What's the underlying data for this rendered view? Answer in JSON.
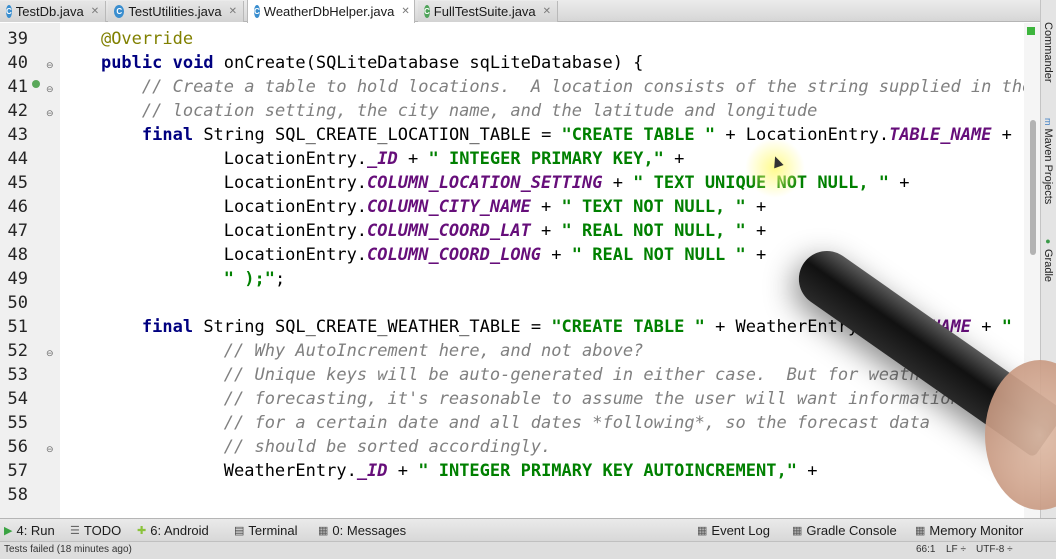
{
  "tabs": [
    {
      "label": "TestDb.java",
      "icon": "java-class-icon",
      "active": false
    },
    {
      "label": "TestUtilities.java",
      "icon": "java-class-icon",
      "active": false
    },
    {
      "label": "WeatherDbHelper.java",
      "icon": "java-class-icon",
      "active": true
    },
    {
      "label": "FullTestSuite.java",
      "icon": "java-class-icon",
      "active": false
    }
  ],
  "right_tools": [
    {
      "label": "Commander"
    },
    {
      "label": "Maven Projects"
    },
    {
      "label": "Gradle"
    }
  ],
  "line_numbers": [
    "39",
    "40",
    "41",
    "42",
    "43",
    "44",
    "45",
    "46",
    "47",
    "48",
    "49",
    "50",
    "51",
    "52",
    "53",
    "54",
    "55",
    "56",
    "57",
    "58"
  ],
  "code": [
    [
      {
        "t": "    "
      },
      {
        "c": "an",
        "t": "@Override"
      }
    ],
    [
      {
        "t": "    "
      },
      {
        "c": "kw",
        "t": "public void "
      },
      {
        "t": "onCreate(SQLiteDatabase sqLiteDatabase) {"
      }
    ],
    [
      {
        "t": "        "
      },
      {
        "c": "cm",
        "t": "// Create a table to hold locations.  A location consists of the string supplied in the"
      }
    ],
    [
      {
        "t": "        "
      },
      {
        "c": "cm",
        "t": "// location setting, the city name, and the latitude and longitude"
      }
    ],
    [
      {
        "t": "        "
      },
      {
        "c": "kw",
        "t": "final "
      },
      {
        "t": "String SQL_CREATE_LOCATION_TABLE = "
      },
      {
        "c": "st",
        "t": "\"CREATE TABLE \""
      },
      {
        "t": " + LocationEntry."
      },
      {
        "c": "fd",
        "t": "TABLE_NAME"
      },
      {
        "t": " + "
      },
      {
        "c": "st",
        "t": "\""
      }
    ],
    [
      {
        "t": "                LocationEntry."
      },
      {
        "c": "fd",
        "t": "_ID"
      },
      {
        "t": " + "
      },
      {
        "c": "st",
        "t": "\" INTEGER PRIMARY KEY,\""
      },
      {
        "t": " +"
      }
    ],
    [
      {
        "t": "                LocationEntry."
      },
      {
        "c": "fd",
        "t": "COLUMN_LOCATION_SETTING"
      },
      {
        "t": " + "
      },
      {
        "c": "st",
        "t": "\" TEXT UNIQUE NOT NULL, \""
      },
      {
        "t": " +"
      }
    ],
    [
      {
        "t": "                LocationEntry."
      },
      {
        "c": "fd",
        "t": "COLUMN_CITY_NAME"
      },
      {
        "t": " + "
      },
      {
        "c": "st",
        "t": "\" TEXT NOT NULL, \""
      },
      {
        "t": " +"
      }
    ],
    [
      {
        "t": "                LocationEntry."
      },
      {
        "c": "fd",
        "t": "COLUMN_COORD_LAT"
      },
      {
        "t": " + "
      },
      {
        "c": "st",
        "t": "\" REAL NOT NULL, \""
      },
      {
        "t": " +"
      }
    ],
    [
      {
        "t": "                LocationEntry."
      },
      {
        "c": "fd",
        "t": "COLUMN_COORD_LONG"
      },
      {
        "t": " + "
      },
      {
        "c": "st",
        "t": "\" REAL NOT NULL \""
      },
      {
        "t": " +"
      }
    ],
    [
      {
        "t": "                "
      },
      {
        "c": "st",
        "t": "\" );\""
      },
      {
        "t": ";"
      }
    ],
    [],
    [
      {
        "t": "        "
      },
      {
        "c": "kw",
        "t": "final "
      },
      {
        "t": "String SQL_CREATE_WEATHER_TABLE = "
      },
      {
        "c": "st",
        "t": "\"CREATE TABLE \""
      },
      {
        "t": " + WeatherEntry."
      },
      {
        "c": "fd",
        "t": "TABLE_NAME"
      },
      {
        "t": " + "
      },
      {
        "c": "st",
        "t": "\" ("
      }
    ],
    [
      {
        "t": "                "
      },
      {
        "c": "cm",
        "t": "// Why AutoIncrement here, and not above?"
      }
    ],
    [
      {
        "t": "                "
      },
      {
        "c": "cm",
        "t": "// Unique keys will be auto-generated in either case.  But for weather"
      }
    ],
    [
      {
        "t": "                "
      },
      {
        "c": "cm",
        "t": "// forecasting, it's reasonable to assume the user will want information"
      }
    ],
    [
      {
        "t": "                "
      },
      {
        "c": "cm",
        "t": "// for a certain date and all dates *following*, so the forecast data"
      }
    ],
    [
      {
        "t": "                "
      },
      {
        "c": "cm",
        "t": "// should be sorted accordingly."
      }
    ],
    [
      {
        "t": "                WeatherEntry."
      },
      {
        "c": "fd",
        "t": "_ID"
      },
      {
        "t": " + "
      },
      {
        "c": "st",
        "t": "\" INTEGER PRIMARY KEY AUTOINCREMENT,\""
      },
      {
        "t": " +"
      }
    ],
    []
  ],
  "tool_windows": [
    {
      "label": "4: Run",
      "icon": "run-icon"
    },
    {
      "label": "TODO",
      "icon": "todo-icon"
    },
    {
      "label": "6: Android",
      "icon": "android-icon"
    },
    {
      "label": "Terminal",
      "icon": "terminal-icon"
    },
    {
      "label": "0: Messages",
      "icon": "messages-icon"
    },
    {
      "label": "Event Log",
      "icon": "event-log-icon"
    },
    {
      "label": "Gradle Console",
      "icon": "gradle-console-icon"
    },
    {
      "label": "Memory Monitor",
      "icon": "memory-monitor-icon"
    }
  ],
  "status": {
    "message": "Tests failed (18 minutes ago)",
    "position": "66:1",
    "line_separator": "LF ÷",
    "encoding": "UTF-8 ÷"
  }
}
